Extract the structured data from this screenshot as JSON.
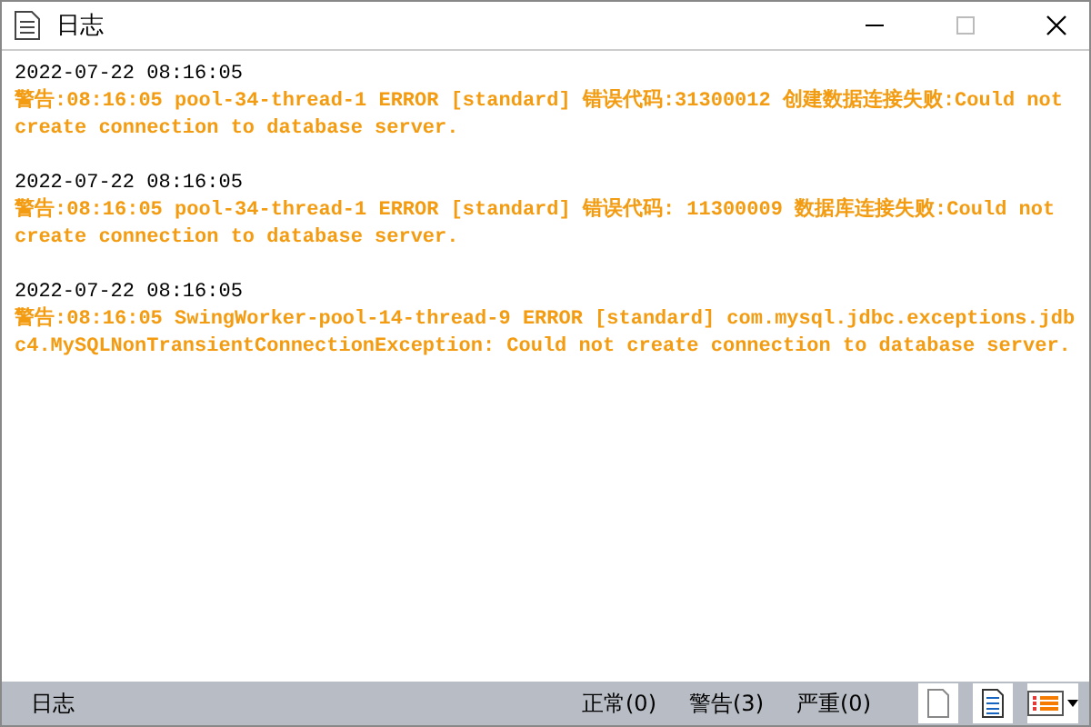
{
  "window": {
    "title": "日志",
    "maximize_disabled": true
  },
  "log_entries": [
    {
      "timestamp": "2022-07-22 08:16:05",
      "kind": "warning",
      "message": "警告:08:16:05 pool-34-thread-1 ERROR [standard] 错误代码:31300012 创建数据连接失败:Could not create connection to database server."
    },
    {
      "timestamp": "2022-07-22 08:16:05",
      "kind": "warning",
      "message": "警告:08:16:05 pool-34-thread-1 ERROR [standard] 错误代码: 11300009 数据库连接失败:Could not create connection to database server."
    },
    {
      "timestamp": "2022-07-22 08:16:05",
      "kind": "warning",
      "message": "警告:08:16:05 SwingWorker-pool-14-thread-9 ERROR [standard] com.mysql.jdbc.exceptions.jdbc4.MySQLNonTransientConnectionException: Could not create connection to database server."
    }
  ],
  "status_bar": {
    "label": "日志",
    "counts": [
      "正常(0)",
      "警告(3)",
      "严重(0)"
    ]
  }
}
